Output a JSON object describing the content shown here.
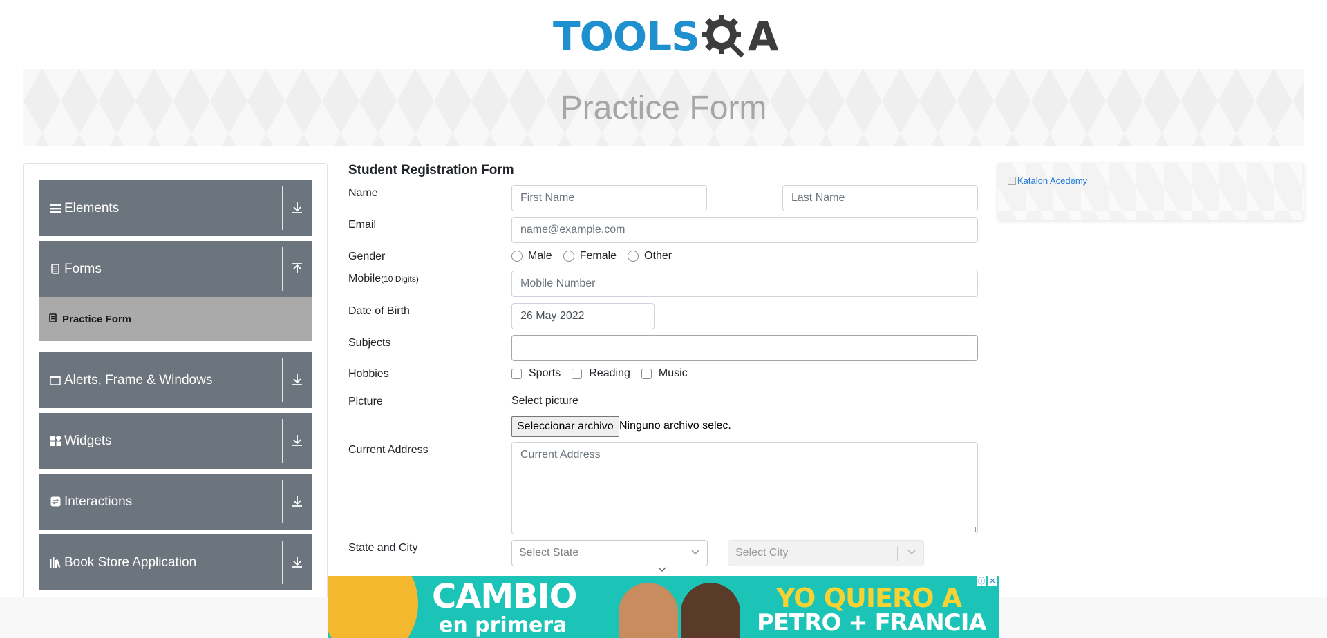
{
  "header": {
    "logo_part1": "TOOLS",
    "logo_part2": "A"
  },
  "banner": {
    "title": "Practice Form"
  },
  "sidebar": {
    "groups": [
      {
        "label": "Elements",
        "icon": "list-icon"
      },
      {
        "label": "Forms",
        "icon": "document-icon"
      },
      {
        "label": "Alerts, Frame & Windows",
        "icon": "window-icon"
      },
      {
        "label": "Widgets",
        "icon": "grid-icon"
      },
      {
        "label": "Interactions",
        "icon": "interaction-icon"
      },
      {
        "label": "Book Store Application",
        "icon": "books-icon"
      }
    ],
    "subitem": "Practice Form"
  },
  "form": {
    "title": "Student Registration Form",
    "labels": {
      "name": "Name",
      "email": "Email",
      "gender": "Gender",
      "mobile": "Mobile",
      "mobile_hint": "(10 Digits)",
      "dob": "Date of Birth",
      "subjects": "Subjects",
      "hobbies": "Hobbies",
      "picture": "Picture",
      "address": "Current Address",
      "state_city": "State and City"
    },
    "first_name_placeholder": "First Name",
    "last_name_placeholder": "Last Name",
    "email_placeholder": "name@example.com",
    "gender_options": [
      "Male",
      "Female",
      "Other"
    ],
    "mobile_placeholder": "Mobile Number",
    "dob_value": "26 May 2022",
    "subjects_value": "",
    "hobbies_options": [
      "Sports",
      "Reading",
      "Music"
    ],
    "select_picture": "Select picture",
    "file_button": "Seleccionar archivo",
    "file_status": "Ninguno archivo selec.",
    "address_placeholder": "Current Address",
    "state_placeholder": "Select State",
    "city_placeholder": "Select City"
  },
  "right_ad": {
    "alt": "Katalon Acedemy"
  },
  "bottom_ad": {
    "line1": "CAMBIO",
    "line2": "en primera",
    "right1": "YO QUIERO A",
    "right2": "PETRO + FRANCIA"
  },
  "colors": {
    "sidebar_group": "#6c757d",
    "sidebar_active": "#aaaaaa",
    "logo_blue": "#1e8fcf",
    "link_blue": "#1e78d6"
  }
}
